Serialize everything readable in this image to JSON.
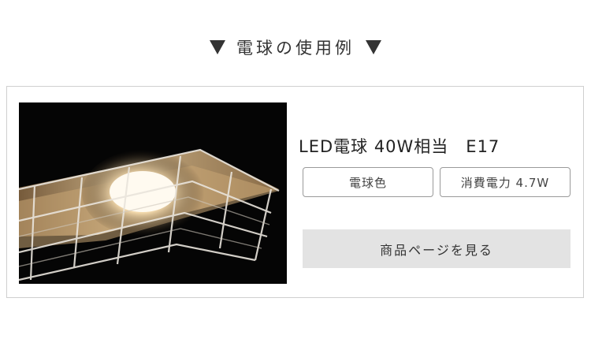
{
  "heading": "電球の使用例",
  "product": {
    "title": "LED電球 40W相当　E17",
    "specs": [
      "電球色",
      "消費電力 4.7W"
    ],
    "view_button": "商品ページを見る"
  },
  "colors": {
    "heading_triangle": "#333333",
    "button_bg": "#e3e3e3",
    "border": "#cfcfcf"
  },
  "icons": [
    "triangle-down-icon",
    "triangle-down-icon"
  ]
}
